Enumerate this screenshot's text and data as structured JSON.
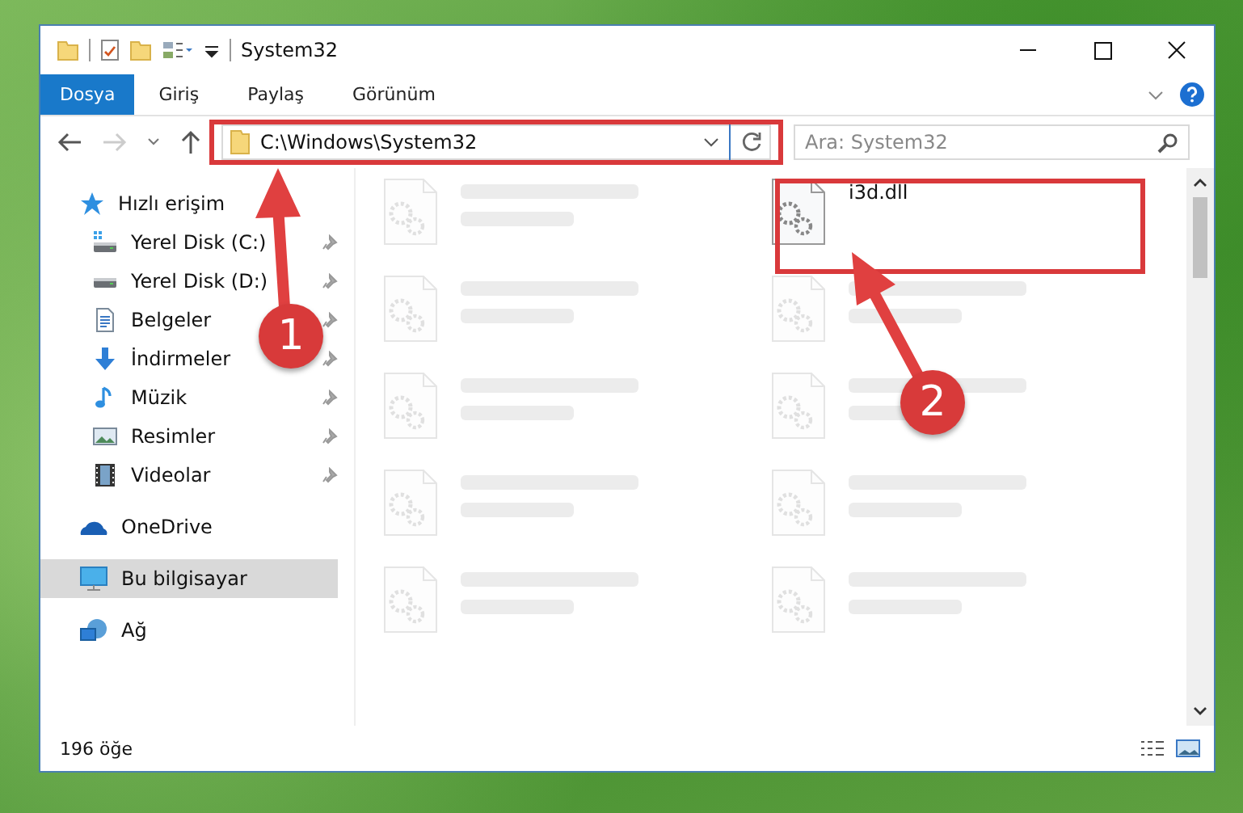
{
  "window": {
    "title": "System32"
  },
  "ribbon_tabs": [
    {
      "label": "Dosya",
      "selected": true
    },
    {
      "label": "Giriş",
      "selected": false
    },
    {
      "label": "Paylaş",
      "selected": false
    },
    {
      "label": "Görünüm",
      "selected": false
    }
  ],
  "address_bar": {
    "path": "C:\\Windows\\System32"
  },
  "search": {
    "placeholder": "Ara: System32"
  },
  "sidebar": {
    "items": [
      {
        "label": "Hızlı erişim",
        "kind": "star",
        "selected": false,
        "children": [
          {
            "label": "Yerel Disk (C:)",
            "kind": "system-drive",
            "pinned": true,
            "selected": false
          },
          {
            "label": "Yerel Disk (D:)",
            "kind": "drive",
            "pinned": true,
            "selected": false
          },
          {
            "label": "Belgeler",
            "kind": "documents",
            "pinned": true,
            "selected": false
          },
          {
            "label": "İndirmeler",
            "kind": "downloads",
            "pinned": true,
            "selected": false
          },
          {
            "label": "Müzik",
            "kind": "music",
            "pinned": true,
            "selected": false
          },
          {
            "label": "Resimler",
            "kind": "pictures",
            "pinned": true,
            "selected": false
          },
          {
            "label": "Videolar",
            "kind": "videos",
            "pinned": true,
            "selected": false
          }
        ]
      },
      {
        "label": "OneDrive",
        "kind": "cloud",
        "selected": false
      },
      {
        "label": "Bu bilgisayar",
        "kind": "computer",
        "selected": true
      },
      {
        "label": "Ağ",
        "kind": "network",
        "selected": false
      }
    ]
  },
  "files": [
    {
      "faded": true
    },
    {
      "name": "i3d.dll",
      "faded": false
    },
    {
      "faded": true
    },
    {
      "faded": true
    },
    {
      "faded": true
    },
    {
      "faded": true
    },
    {
      "faded": true
    },
    {
      "faded": true
    },
    {
      "faded": true
    },
    {
      "faded": true
    }
  ],
  "status_bar": {
    "count": "196 öğe"
  },
  "annotations": [
    {
      "number": "1"
    },
    {
      "number": "2"
    }
  ]
}
